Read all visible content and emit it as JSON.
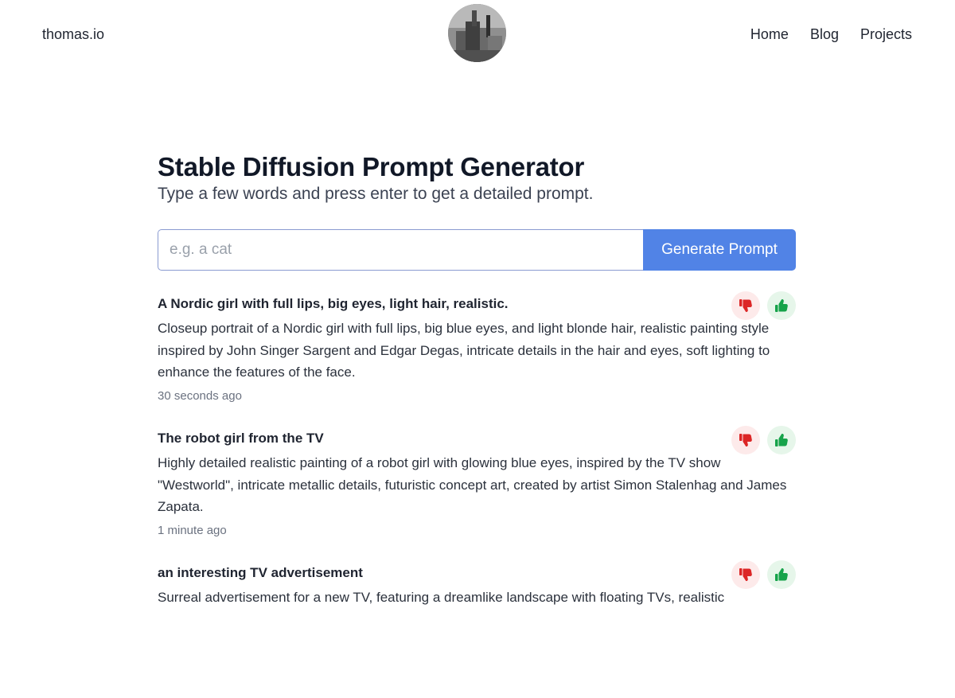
{
  "header": {
    "brand": "thomas.io",
    "nav": [
      "Home",
      "Blog",
      "Projects"
    ]
  },
  "main": {
    "title": "Stable Diffusion Prompt Generator",
    "subtitle": "Type a few words and press enter to get a detailed prompt.",
    "search": {
      "placeholder": "e.g. a cat",
      "value": "",
      "button_label": "Generate Prompt"
    },
    "results": [
      {
        "title": "A Nordic girl with full lips, big eyes, light hair, realistic.",
        "body": "Closeup portrait of a Nordic girl with full lips, big blue eyes, and light blonde hair, realistic painting style inspired by John Singer Sargent and Edgar Degas, intricate details in the hair and eyes, soft lighting to enhance the features of the face.",
        "time": "30 seconds ago"
      },
      {
        "title": "The robot girl from the TV",
        "body": "Highly detailed realistic painting of a robot girl with glowing blue eyes, inspired by the TV show \"Westworld\", intricate metallic details, futuristic concept art, created by artist Simon Stalenhag and James Zapata.",
        "time": "1 minute ago"
      },
      {
        "title": "an interesting TV advertisement",
        "body": "Surreal advertisement for a new TV, featuring a dreamlike landscape with floating TVs, realistic",
        "time": ""
      }
    ]
  },
  "colors": {
    "accent": "#5183e6",
    "downvote": "#dc2626",
    "upvote": "#16a34a"
  },
  "icons": {
    "downvote": "thumbs-down-icon",
    "upvote": "thumbs-up-icon"
  }
}
